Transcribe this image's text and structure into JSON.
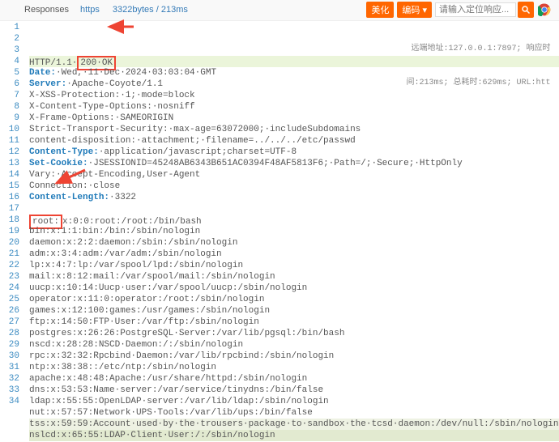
{
  "topbar": {
    "title": "Responses",
    "tab1": "https",
    "tab2": "3322bytes / 213ms",
    "btn1": "美化",
    "btn2": "编码",
    "search_ph": "请输入定位响应..."
  },
  "meta": {
    "addr_label": "远端地址:",
    "addr": "127.0.0.1:7897; 响应时",
    "timing": "间:213ms; 总耗时:629ms; URL:htt"
  },
  "lines": [
    {
      "n": 1,
      "type": "http",
      "pre": "HTTP/1.1·",
      "box": "200·OK",
      "first": true
    },
    {
      "n": 2,
      "type": "hdr",
      "k": "Date:",
      "v": "·Wed,·11·Dec·2024·03:03:04·GMT"
    },
    {
      "n": 3,
      "type": "hdr",
      "k": "Server:",
      "v": "·Apache-Coyote/1.1"
    },
    {
      "n": 4,
      "type": "plain",
      "v": "X-XSS-Protection:·1;·mode=block"
    },
    {
      "n": 5,
      "type": "plain",
      "v": "X-Content-Type-Options:·nosniff"
    },
    {
      "n": 6,
      "type": "plain",
      "v": "X-Frame-Options:·SAMEORIGIN"
    },
    {
      "n": 7,
      "type": "plain",
      "v": "Strict-Transport-Security:·max-age=63072000;·includeSubdomains"
    },
    {
      "n": 8,
      "type": "plain",
      "v": "content-disposition:·attachment;·filename=../../../etc/passwd"
    },
    {
      "n": 9,
      "type": "hdr",
      "k": "Content-Type:",
      "v": "·application/javascript;charset=UTF-8"
    },
    {
      "n": 10,
      "type": "hdr",
      "k": "Set-Cookie:",
      "v": "·JSESSIONID=45248AB6343B651AC0394F48AF5813F6;·Path=/;·Secure;·HttpOnly"
    },
    {
      "n": 11,
      "type": "plain",
      "v": "Vary:·Accept-Encoding,User-Agent"
    },
    {
      "n": 12,
      "type": "plain",
      "v": "Connection:·close"
    },
    {
      "n": 13,
      "type": "hdr",
      "k": "Content-Length:",
      "v": "·3322"
    },
    {
      "n": 14,
      "type": "plain",
      "v": ""
    },
    {
      "n": 15,
      "type": "root",
      "box": "root:",
      "v": "x:0:0:root:/root:/bin/bash"
    },
    {
      "n": 16,
      "type": "plain",
      "v": "bin:x:1:1:bin:/bin:/sbin/nologin"
    },
    {
      "n": 17,
      "type": "plain",
      "v": "daemon:x:2:2:daemon:/sbin:/sbin/nologin"
    },
    {
      "n": 18,
      "type": "plain",
      "v": "adm:x:3:4:adm:/var/adm:/sbin/nologin"
    },
    {
      "n": 19,
      "type": "plain",
      "v": "lp:x:4:7:lp:/var/spool/lpd:/sbin/nologin"
    },
    {
      "n": 20,
      "type": "plain",
      "v": "mail:x:8:12:mail:/var/spool/mail:/sbin/nologin"
    },
    {
      "n": 21,
      "type": "plain",
      "v": "uucp:x:10:14:Uucp·user:/var/spool/uucp:/sbin/nologin"
    },
    {
      "n": 22,
      "type": "plain",
      "v": "operator:x:11:0:operator:/root:/sbin/nologin"
    },
    {
      "n": 23,
      "type": "plain",
      "v": "games:x:12:100:games:/usr/games:/sbin/nologin"
    },
    {
      "n": 24,
      "type": "plain",
      "v": "ftp:x:14:50:FTP·User:/var/ftp:/sbin/nologin"
    },
    {
      "n": 25,
      "type": "plain",
      "v": "postgres:x:26:26:PostgreSQL·Server:/var/lib/pgsql:/bin/bash"
    },
    {
      "n": 26,
      "type": "plain",
      "v": "nscd:x:28:28:NSCD·Daemon:/:/sbin/nologin"
    },
    {
      "n": 27,
      "type": "plain",
      "v": "rpc:x:32:32:Rpcbind·Daemon:/var/lib/rpcbind:/sbin/nologin"
    },
    {
      "n": 28,
      "type": "plain",
      "v": "ntp:x:38:38::/etc/ntp:/sbin/nologin"
    },
    {
      "n": 29,
      "type": "plain",
      "v": "apache:x:48:48:Apache:/usr/share/httpd:/sbin/nologin"
    },
    {
      "n": 30,
      "type": "plain",
      "v": "dns:x:53:53:Name·server:/var/service/tinydns:/bin/false"
    },
    {
      "n": 31,
      "type": "plain",
      "v": "ldap:x:55:55:OpenLDAP·server:/var/lib/ldap:/sbin/nologin"
    },
    {
      "n": 32,
      "type": "plain",
      "v": "nut:x:57:57:Network·UPS·Tools:/var/lib/ups:/bin/false"
    },
    {
      "n": 33,
      "type": "hl33",
      "v": "tss:x:59:59:Account·used·by·the·trousers·package·to·sandbox·the·tcsd·daemon:/dev/null:/sbin/nologin"
    },
    {
      "n": 34,
      "type": "hl34",
      "v": "nslcd:x:65:55:LDAP·Client·User:/:/sbin/nologin"
    }
  ]
}
